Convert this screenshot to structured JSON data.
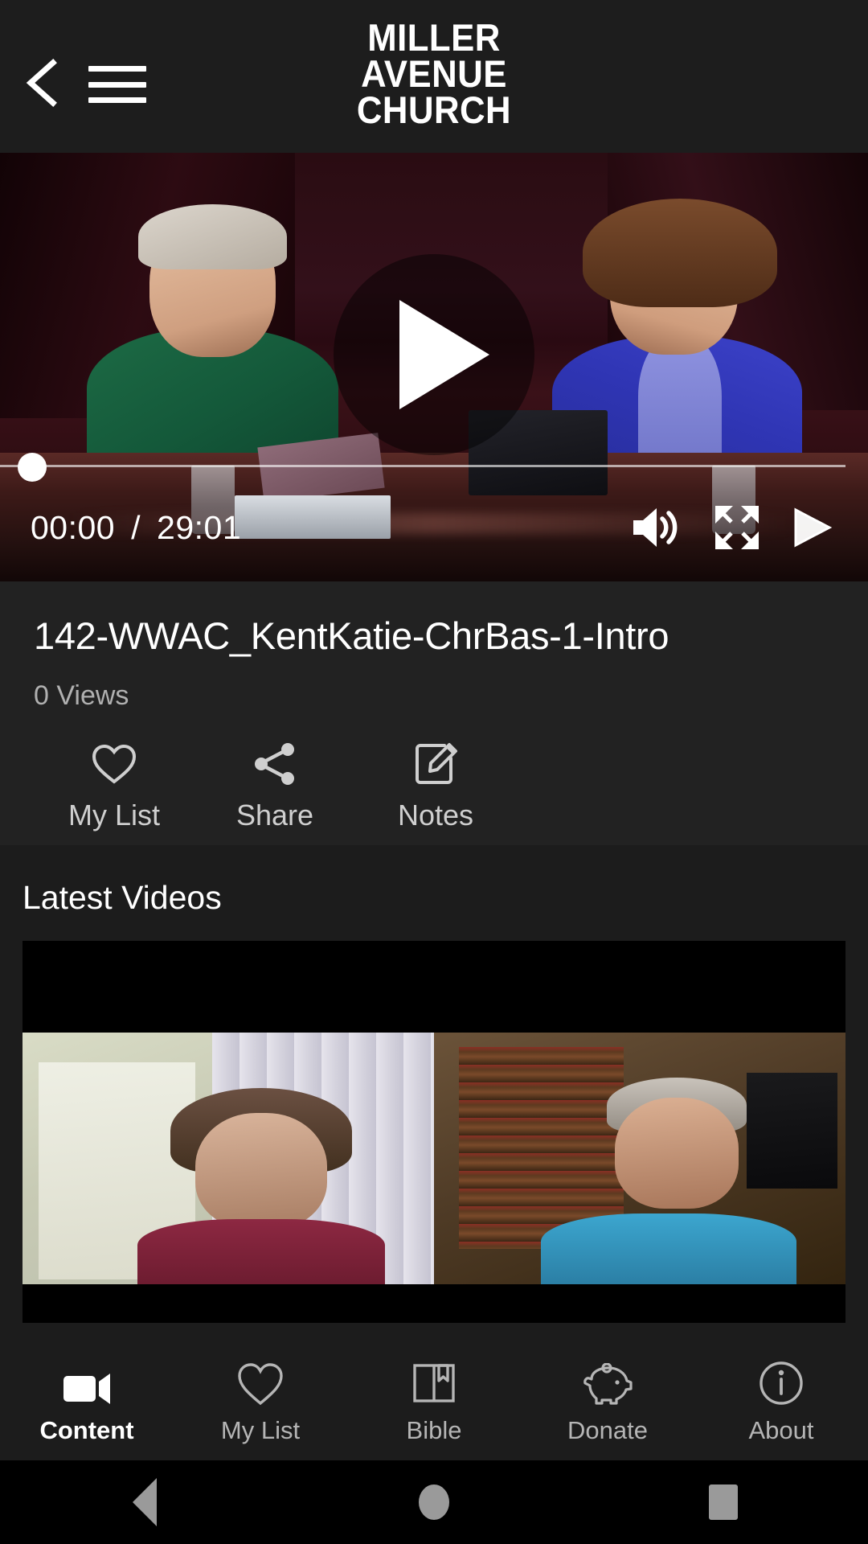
{
  "header": {
    "back_icon": "chevron-left-icon",
    "menu_icon": "hamburger-menu-icon",
    "logo_line1": "MILLER",
    "logo_line2": "AVENUE",
    "logo_line3": "CHURCH"
  },
  "player": {
    "state": "paused",
    "play_icon": "play-triangle-icon",
    "current_time": "00:00",
    "separator": "/",
    "duration": "29:01",
    "progress_percent": 0,
    "controls": [
      {
        "name": "volume-icon",
        "label": "Volume"
      },
      {
        "name": "fullscreen-icon",
        "label": "Fullscreen"
      },
      {
        "name": "cast-icon",
        "label": "Cast"
      }
    ]
  },
  "video": {
    "title": "142-WWAC_KentKatie-ChrBas-1-Intro",
    "views": "0 Views",
    "actions": [
      {
        "icon": "heart-outline-icon",
        "label": "My List"
      },
      {
        "icon": "share-nodes-icon",
        "label": "Share"
      },
      {
        "icon": "note-pencil-icon",
        "label": "Notes"
      }
    ]
  },
  "latest": {
    "heading": "Latest Videos",
    "items": [
      {
        "name": "video-thumbnail"
      }
    ]
  },
  "tabbar": {
    "tabs": [
      {
        "icon": "video-camera-icon",
        "label": "Content",
        "active": true
      },
      {
        "icon": "heart-outline-icon",
        "label": "My List",
        "active": false
      },
      {
        "icon": "bible-book-icon",
        "label": "Bible",
        "active": false
      },
      {
        "icon": "piggy-bank-icon",
        "label": "Donate",
        "active": false
      },
      {
        "icon": "info-circle-icon",
        "label": "About",
        "active": false
      }
    ]
  },
  "sysnav": {
    "back": "android-back-icon",
    "home": "android-home-icon",
    "recents": "android-recents-icon"
  },
  "colors": {
    "header_bg": "#1d1d1d",
    "info_bg": "#222222",
    "page_bg": "#1c1c1c",
    "accent_text": "#ffffff",
    "muted_text": "#b0b0b0"
  }
}
